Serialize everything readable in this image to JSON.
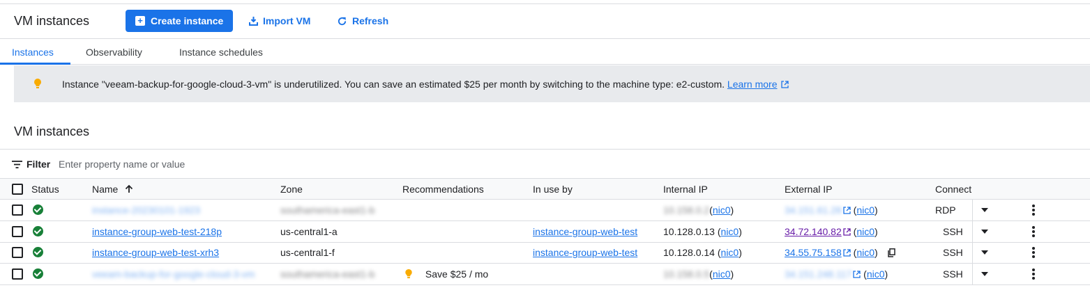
{
  "header": {
    "title": "VM instances",
    "create_label": "Create instance",
    "import_label": "Import VM",
    "refresh_label": "Refresh"
  },
  "tabs": [
    {
      "label": "Instances",
      "active": true
    },
    {
      "label": "Observability",
      "active": false
    },
    {
      "label": "Instance schedules",
      "active": false
    }
  ],
  "banner": {
    "text": "Instance \"veeam-backup-for-google-cloud-3-vm\" is underutilized. You can save an estimated $25 per month by switching to the machine type: e2-custom.",
    "link": "Learn more"
  },
  "section_title": "VM instances",
  "filter": {
    "label": "Filter",
    "placeholder": "Enter property name or value"
  },
  "columns": {
    "status": "Status",
    "name": "Name",
    "zone": "Zone",
    "recommendations": "Recommendations",
    "in_use_by": "In use by",
    "internal_ip": "Internal IP",
    "external_ip": "External IP",
    "connect": "Connect"
  },
  "rows": [
    {
      "name": "instance-20230101-1923",
      "zone": "southamerica-east1-b",
      "recommendation": "",
      "in_use_by": "",
      "internal_ip": "10.158.0.2",
      "internal_nic": "nic0",
      "external_ip": "34.151.61.28",
      "external_nic": "nic0",
      "connect": "RDP"
    },
    {
      "name": "instance-group-web-test-218p",
      "zone": "us-central1-a",
      "recommendation": "",
      "in_use_by": "instance-group-web-test",
      "internal_ip": "10.128.0.13",
      "internal_nic": "nic0",
      "external_ip": "34.72.140.82",
      "external_nic": "nic0",
      "connect": "SSH"
    },
    {
      "name": "instance-group-web-test-xrh3",
      "zone": "us-central1-f",
      "recommendation": "",
      "in_use_by": "instance-group-web-test",
      "internal_ip": "10.128.0.14",
      "internal_nic": "nic0",
      "external_ip": "34.55.75.158",
      "external_nic": "nic0",
      "connect": "SSH"
    },
    {
      "name": "veeam-backup-for-google-cloud-3-vm",
      "zone": "southamerica-east1-b",
      "recommendation": "Save $25 / mo",
      "in_use_by": "",
      "internal_ip": "10.158.0.5",
      "internal_nic": "nic0",
      "external_ip": "34.151.248.117",
      "external_nic": "nic0",
      "connect": "SSH"
    }
  ],
  "colors": {
    "primary": "#1a73e8",
    "success": "#188038",
    "warning": "#f9ab00",
    "banner_bg": "#e8eaed"
  }
}
